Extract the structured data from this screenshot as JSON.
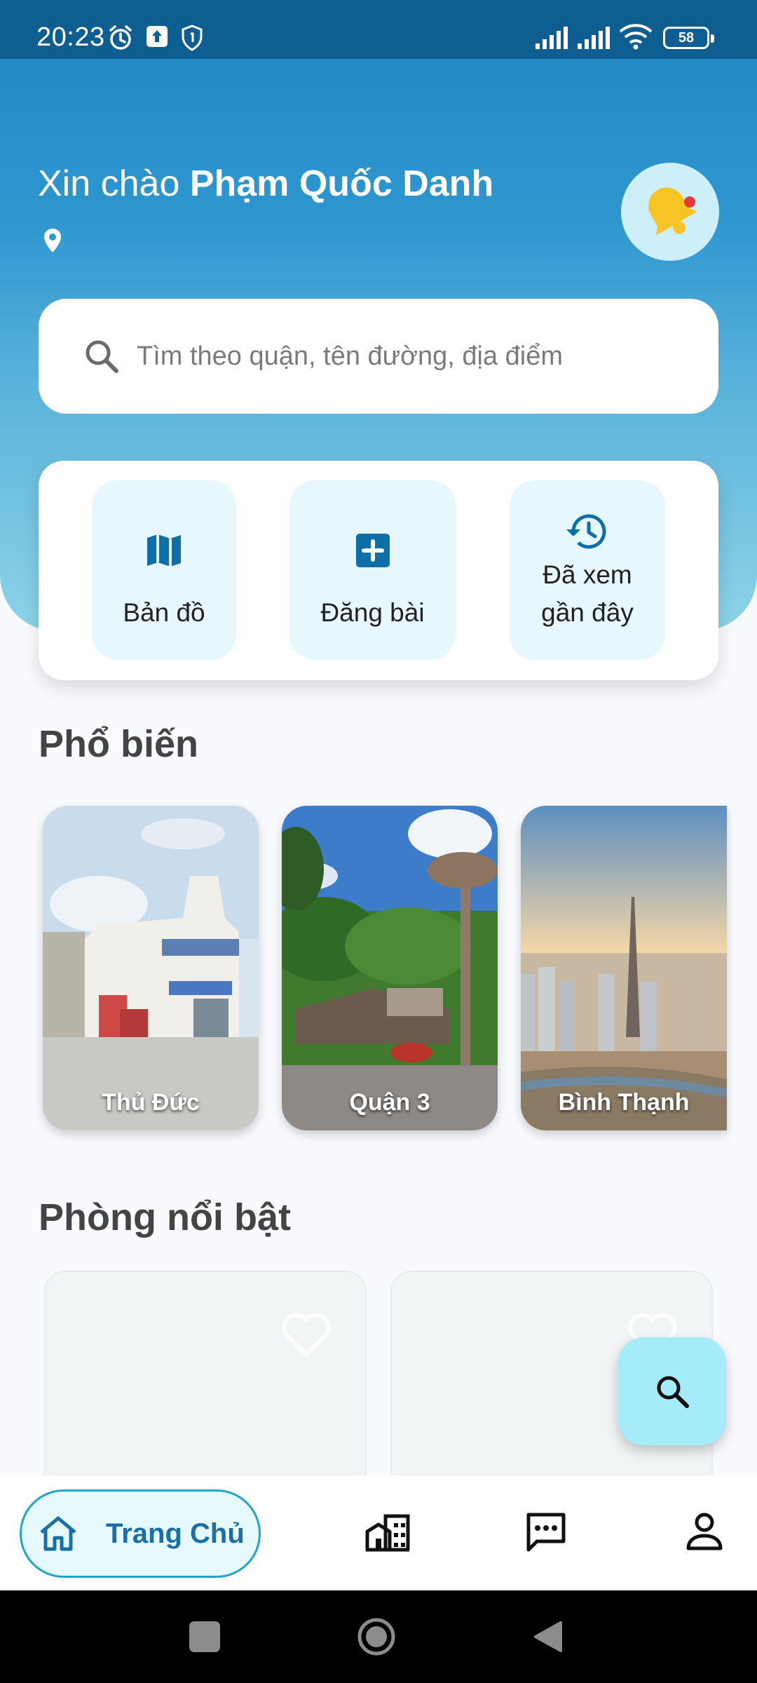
{
  "status_bar": {
    "time": "20:23",
    "battery": "58",
    "icons": [
      "alarm-icon",
      "upload-notification-icon",
      "shield-notification-icon",
      "signal-icon",
      "signal-icon",
      "wifi-icon",
      "battery-icon"
    ]
  },
  "header": {
    "greeting_prefix": "Xin chào ",
    "user_name": "Phạm Quốc Danh",
    "location_icon": "location-pin-icon",
    "notification_icon": "bell-icon"
  },
  "search": {
    "placeholder": "Tìm theo quận, tên đường, địa điểm"
  },
  "quick_actions": [
    {
      "label": "Bản đồ",
      "icon": "map-icon"
    },
    {
      "label": "Đăng bài",
      "icon": "add-post-icon"
    },
    {
      "label_line1": "Đã xem",
      "label_line2": "gần đây",
      "icon": "history-icon"
    }
  ],
  "popular": {
    "title": "Phổ biến",
    "items": [
      {
        "label": "Thủ Đức"
      },
      {
        "label": "Quận 3"
      },
      {
        "label": "Bình Thạnh"
      }
    ]
  },
  "featured": {
    "title": "Phòng nổi bật"
  },
  "bottom_nav": {
    "home_label": "Trang Chủ",
    "items": [
      "home-icon",
      "building-icon",
      "chat-icon",
      "profile-icon"
    ]
  },
  "colors": {
    "header_dark": "#0e5e92",
    "header_blue": "#1f86c6",
    "accent_cyan": "#21a6c9",
    "action_bg": "#e6f8fd",
    "fab_bg": "#a5ecfb",
    "nav_label": "#1a6fa6"
  }
}
